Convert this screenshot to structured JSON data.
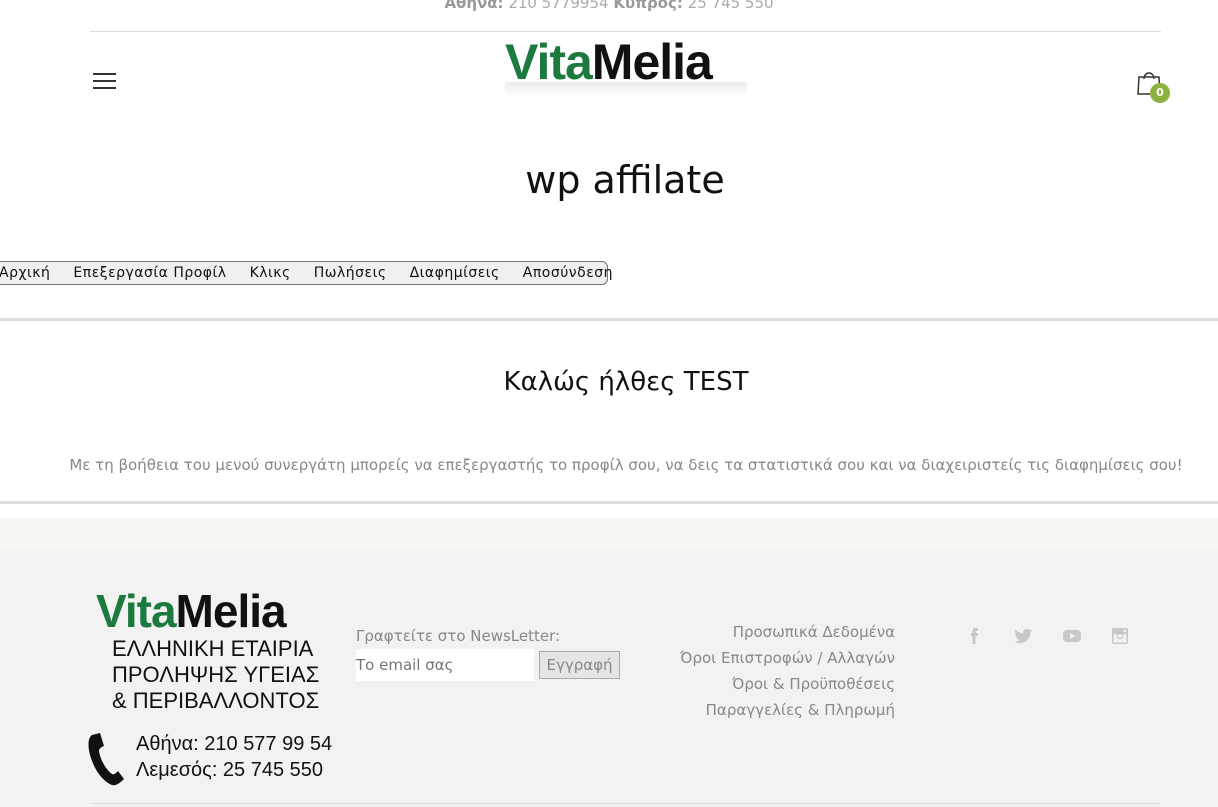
{
  "topbar": {
    "athens_label": "Αθηνα:",
    "athens_phone": "210 5779954",
    "cyprus_label": "Κυπρος:",
    "cyprus_phone": "25 745 550"
  },
  "header": {
    "logo_vita": "Vita",
    "logo_melia": "Melia",
    "cart_count": "0"
  },
  "page": {
    "title": "wp affilate"
  },
  "nav": {
    "items": [
      "Αρχική",
      "Επεξεργασία Προφίλ",
      "Κλικς",
      "Πωλήσεις",
      "Διαφημίσεις",
      "Αποσύνδεση"
    ]
  },
  "main": {
    "welcome": "Καλώς ήλθες TEST",
    "description": "Με τη βοήθεια του μενού συνεργάτη μπορείς να επεξεργαστής το προφίλ σου, να δεις τα στατιστικά σου και να διαχειριστείς τις διαφημίσεις σου!"
  },
  "footer": {
    "logo_vita": "Vita",
    "logo_melia": "Melia",
    "tagline_1": "ΕΛΛΗΝΙΚΗ ΕΤΑΙΡΙΑ",
    "tagline_2": "ΠΡΟΛΗΨΗΣ ΥΓΕΙΑΣ",
    "tagline_3": "& ΠΕΡΙΒΑΛΛΟΝΤΟΣ",
    "phone_athens": "Αθήνα: 210 577 99 54",
    "phone_limassol": "Λεμεσός: 25 745 550",
    "newsletter_label": "Γραφτείτε στο NewsLetter:",
    "newsletter_placeholder": "Το email σας",
    "newsletter_button": "Εγγραφή",
    "links": [
      "Προσωπικά Δεδομένα",
      "Όροι Επιστροφών / Αλλαγών",
      "Όροι & Προϋποθέσεις",
      "Παραγγελίες & Πληρωμή"
    ],
    "social_icons": [
      "facebook-icon",
      "twitter-icon",
      "youtube-icon",
      "instagram-icon"
    ]
  }
}
